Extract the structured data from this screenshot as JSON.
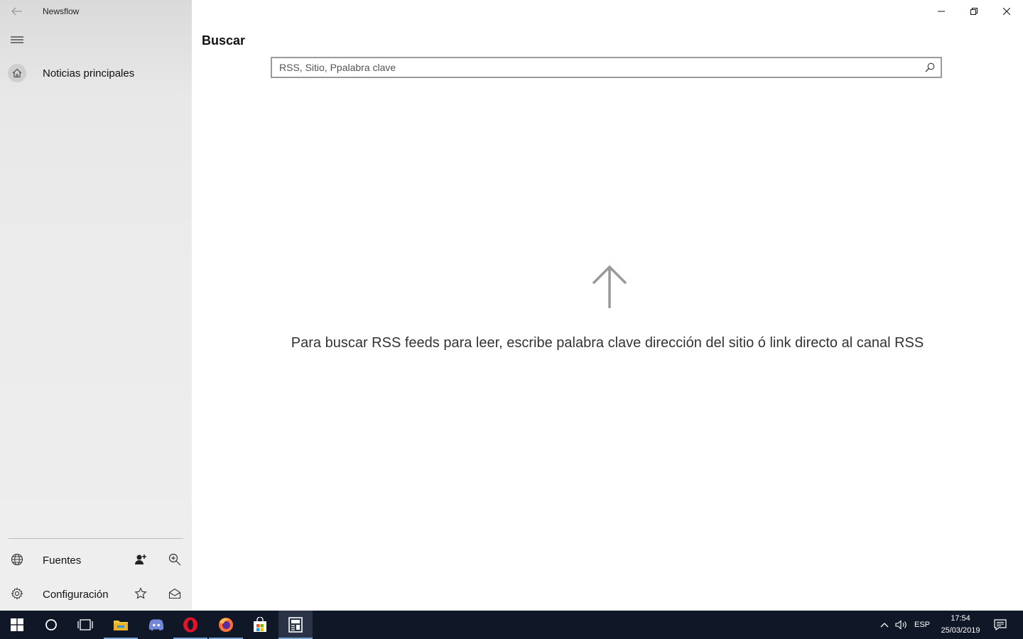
{
  "app": {
    "title": "Newsflow"
  },
  "sidebar": {
    "nav": [
      {
        "label": "Noticias principales",
        "icon": "home-icon"
      }
    ],
    "footer": [
      {
        "label": "Fuentes",
        "icon": "globe-icon",
        "action_icon": "person-add-icon",
        "action2_icon": "zoom-in-icon"
      },
      {
        "label": "Configuración",
        "icon": "gear-icon",
        "action_icon": "star-icon",
        "action2_icon": "mail-open-icon"
      }
    ]
  },
  "main": {
    "title": "Buscar",
    "search": {
      "placeholder": "RSS, Sitio, Ppalabra clave",
      "value": ""
    },
    "hint": "Para buscar RSS feeds para leer, escribe palabra clave dirección del sitio ó link directo al canal RSS"
  },
  "taskbar": {
    "apps": [
      "start-icon",
      "cortana-icon",
      "task-view-icon",
      "file-explorer-icon",
      "discord-icon",
      "opera-icon",
      "firefox-icon",
      "store-icon",
      "newsflow-icon"
    ],
    "language": "ESP",
    "time": "17:54",
    "date": "25/03/2019"
  },
  "colors": {
    "taskbar": "#101727",
    "sidebar": "#e8e8e8",
    "accent": "#7aa3d8"
  }
}
